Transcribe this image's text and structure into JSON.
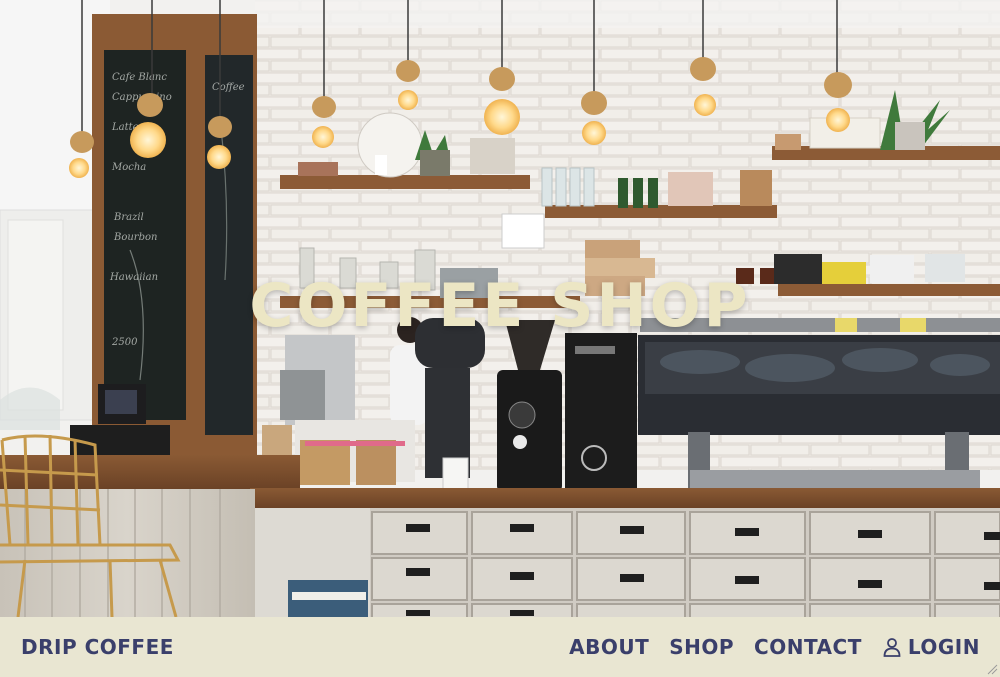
{
  "hero": {
    "title": "COFFEE SHOP",
    "image": "coffee-shop-interior-photo"
  },
  "navbar": {
    "brand": "DRIP COFFEE",
    "links": [
      {
        "label": "ABOUT"
      },
      {
        "label": "SHOP"
      },
      {
        "label": "CONTACT"
      },
      {
        "label": "LOGIN",
        "icon": "user-icon"
      }
    ]
  },
  "colors": {
    "nav_background": "#e9e6d2",
    "nav_text": "#3a3f6b",
    "hero_title": "#ece6c4"
  }
}
